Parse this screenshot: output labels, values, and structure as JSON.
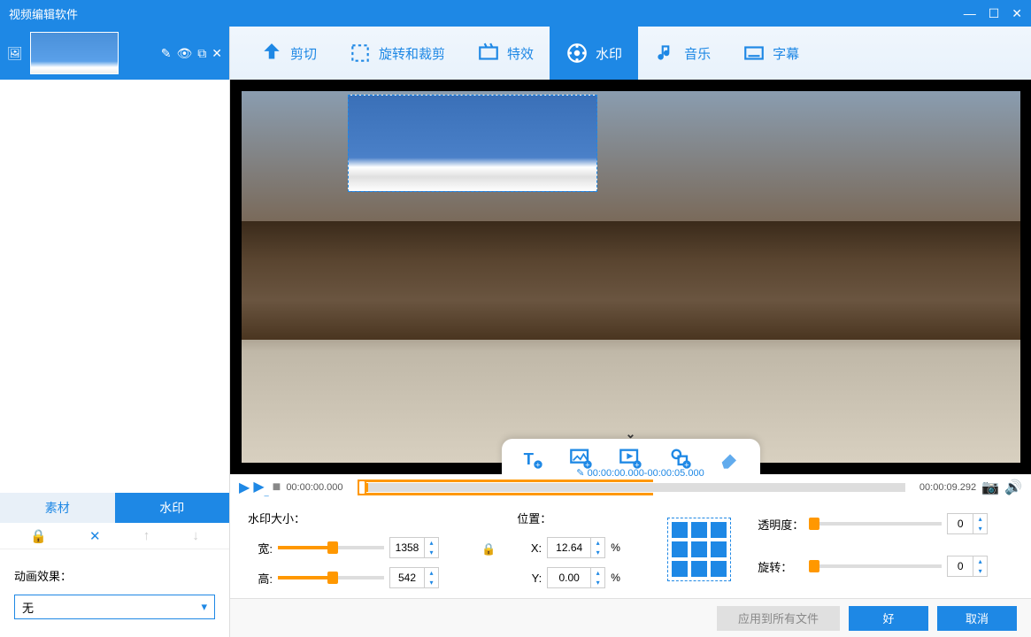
{
  "titlebar": {
    "title": "视频编辑软件"
  },
  "sidebar": {
    "tabs": {
      "material": "素材",
      "watermark": "水印"
    },
    "animation": {
      "label": "动画效果：",
      "value": "无"
    }
  },
  "topTabs": {
    "cut": "剪切",
    "rotate": "旋转和裁剪",
    "effect": "特效",
    "watermark": "水印",
    "music": "音乐",
    "subtitle": "字幕"
  },
  "timeline": {
    "start": "00:00:00.000",
    "range": "00:00:00.000-00:00:05.000",
    "end": "00:00:09.292"
  },
  "params": {
    "sizeTitle": "水印大小：",
    "widthLabel": "宽:",
    "widthValue": "1358",
    "heightLabel": "高:",
    "heightValue": "542",
    "positionTitle": "位置：",
    "xLabel": "X:",
    "xValue": "12.64",
    "yLabel": "Y:",
    "yValue": "0.00",
    "percent": "%",
    "opacityLabel": "透明度：",
    "opacityValue": "0",
    "rotateLabel": "旋转：",
    "rotateValue": "0"
  },
  "buttons": {
    "applyAll": "应用到所有文件",
    "ok": "好",
    "cancel": "取消"
  }
}
